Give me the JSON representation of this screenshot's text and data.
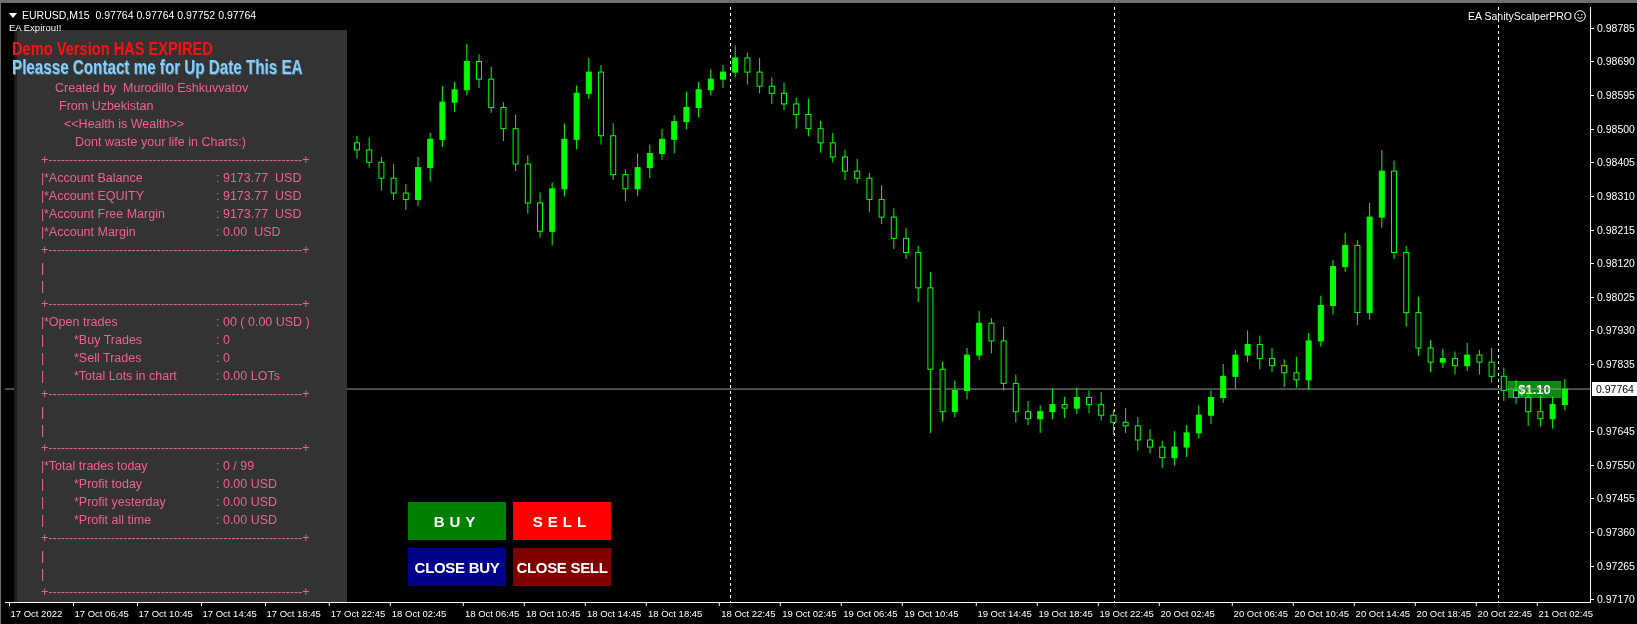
{
  "header": {
    "symbol_line": "EURUSD,M15  0.97764 0.97764 0.97752 0.97764",
    "ea_status": "EA Expirou!!",
    "ea_name": "EA SanityScalperPRO"
  },
  "alerts": [
    {
      "kind": "error",
      "text": "Demo Version HAS EXPIRED"
    },
    {
      "kind": "notice",
      "text": "Pleasse Contact me for Up Date This EA"
    }
  ],
  "panel": {
    "rows": [
      {
        "kind": "text",
        "text": "Created by  Murodillo Eshkuvvatov"
      },
      {
        "kind": "text",
        "text": "From Uzbekistan"
      },
      {
        "kind": "text",
        "text": "<<Health is Wealth>>"
      },
      {
        "kind": "text",
        "text": "Dont waste your life in Charts:)"
      },
      {
        "kind": "rule",
        "text": "+-------------------------------------------------------------+"
      },
      {
        "kind": "stat",
        "bar": "|",
        "label": "*Account Balance",
        "value": ": 9173.77  USD"
      },
      {
        "kind": "stat",
        "bar": "|",
        "label": "*Account EQUITY",
        "value": ": 9173.77  USD"
      },
      {
        "kind": "stat",
        "bar": "|",
        "label": "*Account Free Margin",
        "value": ": 9173.77  USD"
      },
      {
        "kind": "stat",
        "bar": "|",
        "label": "*Account Margin",
        "value": ": 0.00  USD"
      },
      {
        "kind": "rule",
        "text": "+-------------------------------------------------------------+"
      },
      {
        "kind": "bar",
        "text": "|"
      },
      {
        "kind": "bar",
        "text": "|"
      },
      {
        "kind": "rule",
        "text": "+-------------------------------------------------------------+"
      },
      {
        "kind": "stat",
        "bar": "|",
        "label": "*Open trades",
        "value": ": 00 ( 0.00 USD )"
      },
      {
        "kind": "substat",
        "bar": "|",
        "label": "*Buy Trades",
        "value": ": 0"
      },
      {
        "kind": "substat",
        "bar": "|",
        "label": "*Sell Trades",
        "value": ": 0"
      },
      {
        "kind": "substat",
        "bar": "|",
        "label": "*Total Lots in chart",
        "value": ": 0.00 LOTs"
      },
      {
        "kind": "rule",
        "text": "+-------------------------------------------------------------+"
      },
      {
        "kind": "bar",
        "text": "|"
      },
      {
        "kind": "bar",
        "text": "|"
      },
      {
        "kind": "rule",
        "text": "+-------------------------------------------------------------+"
      },
      {
        "kind": "stat",
        "bar": "|",
        "label": "*Total trades today",
        "value": ": 0 / 99"
      },
      {
        "kind": "substat",
        "bar": "|",
        "label": "*Profit today",
        "value": ": 0.00 USD"
      },
      {
        "kind": "substat",
        "bar": "|",
        "label": "*Profit yesterday",
        "value": ": 0.00 USD"
      },
      {
        "kind": "substat",
        "bar": "|",
        "label": "*Profit all time",
        "value": ": 0.00 USD"
      },
      {
        "kind": "rule",
        "text": "+-------------------------------------------------------------+"
      },
      {
        "kind": "bar",
        "text": "|"
      },
      {
        "kind": "bar",
        "text": "|"
      },
      {
        "kind": "rule",
        "text": "+-------------------------------------------------------------+"
      }
    ]
  },
  "buttons": [
    {
      "kind": "buy",
      "label": "BUY"
    },
    {
      "kind": "sell",
      "label": "SELL"
    },
    {
      "kind": "close_buy",
      "label": "CLOSE BUY"
    },
    {
      "kind": "close_sell",
      "label": "CLOSE SELL"
    }
  ],
  "profit_label": "$1.10",
  "current_price": "0.97764",
  "chart": {
    "chart_data": {
      "type": "candlestick",
      "categories": [
        "17 Oct 22:45",
        null,
        null,
        null,
        null,
        "18 Oct 02:45",
        null,
        null,
        null,
        null,
        null,
        "18 Oct 06:45",
        null,
        null,
        null,
        null,
        "18 Oct 10:45",
        null,
        null,
        null,
        null,
        "18 Oct 14:45",
        null,
        null,
        null,
        null,
        "18 Oct 18:45",
        null,
        null,
        null,
        null,
        null,
        "18 Oct 22:45",
        null,
        null,
        null,
        null,
        "19 Oct 02:45",
        null,
        null,
        null,
        null,
        "19 Oct 06:45",
        null,
        null,
        null,
        null,
        "19 Oct 10:45",
        null,
        null,
        null,
        null,
        null,
        "19 Oct 14:45",
        null,
        null,
        null,
        null,
        "19 Oct 18:45",
        null,
        null,
        null,
        null,
        "19 Oct 22:45",
        null,
        null,
        null,
        null,
        "20 Oct 02:45",
        null,
        null,
        null,
        null,
        null,
        "20 Oct 06:45",
        null,
        null,
        null,
        null,
        "20 Oct 10:45",
        null,
        null,
        null,
        null,
        "20 Oct 14:45",
        null,
        null,
        null,
        null,
        "20 Oct 18:45",
        null,
        null,
        null,
        null,
        "20 Oct 22:45",
        null,
        null,
        null,
        null,
        "21 Oct 02:45"
      ],
      "ohlc": [
        [
          0.9846,
          0.9848,
          0.98415,
          0.9844
        ],
        [
          0.9844,
          0.98475,
          0.9839,
          0.98405
        ],
        [
          0.98405,
          0.9842,
          0.98325,
          0.9836
        ],
        [
          0.9836,
          0.984,
          0.98298,
          0.98318
        ],
        [
          0.98318,
          0.98343,
          0.9827,
          0.983
        ],
        [
          0.983,
          0.9842,
          0.98282,
          0.9839
        ],
        [
          0.9839,
          0.98488,
          0.9835,
          0.9847
        ],
        [
          0.9847,
          0.9862,
          0.98448,
          0.98575
        ],
        [
          0.98575,
          0.98632,
          0.98547,
          0.9861
        ],
        [
          0.9861,
          0.9874,
          0.98594,
          0.9869
        ],
        [
          0.9869,
          0.9871,
          0.98615,
          0.9864
        ],
        [
          0.9864,
          0.98675,
          0.98545,
          0.9856
        ],
        [
          0.9856,
          0.98575,
          0.98465,
          0.985
        ],
        [
          0.985,
          0.9854,
          0.9838,
          0.984
        ],
        [
          0.984,
          0.98425,
          0.9826,
          0.9829
        ],
        [
          0.9829,
          0.9832,
          0.98192,
          0.9821
        ],
        [
          0.9821,
          0.98348,
          0.9817,
          0.9833
        ],
        [
          0.9833,
          0.98515,
          0.98308,
          0.9847
        ],
        [
          0.9847,
          0.98622,
          0.98442,
          0.986
        ],
        [
          0.986,
          0.987,
          0.98584,
          0.9866
        ],
        [
          0.9866,
          0.9868,
          0.98455,
          0.9848
        ],
        [
          0.9848,
          0.98515,
          0.98355,
          0.9837
        ],
        [
          0.9837,
          0.98385,
          0.98295,
          0.9833
        ],
        [
          0.9833,
          0.9843,
          0.9831,
          0.9839
        ],
        [
          0.9839,
          0.98455,
          0.9836,
          0.9843
        ],
        [
          0.9843,
          0.985,
          0.98412,
          0.9847
        ],
        [
          0.9847,
          0.98538,
          0.9843,
          0.9852
        ],
        [
          0.9852,
          0.98605,
          0.98498,
          0.9856
        ],
        [
          0.9856,
          0.98632,
          0.98532,
          0.9861
        ],
        [
          0.9861,
          0.98668,
          0.98594,
          0.9864
        ],
        [
          0.9864,
          0.9868,
          0.98615,
          0.9866
        ],
        [
          0.9866,
          0.98735,
          0.98645,
          0.987
        ],
        [
          0.987,
          0.98715,
          0.98625,
          0.9866
        ],
        [
          0.9866,
          0.987,
          0.986,
          0.9862
        ],
        [
          0.9862,
          0.98645,
          0.9857,
          0.986
        ],
        [
          0.986,
          0.9863,
          0.98552,
          0.9857
        ],
        [
          0.9857,
          0.98588,
          0.985,
          0.9854
        ],
        [
          0.9854,
          0.98585,
          0.98478,
          0.985
        ],
        [
          0.985,
          0.98522,
          0.98432,
          0.9846
        ],
        [
          0.9846,
          0.98488,
          0.98404,
          0.9842
        ],
        [
          0.9842,
          0.9844,
          0.98355,
          0.9838
        ],
        [
          0.9838,
          0.98415,
          0.98345,
          0.9836
        ],
        [
          0.9836,
          0.98375,
          0.98265,
          0.983
        ],
        [
          0.983,
          0.9834,
          0.9823,
          0.9825
        ],
        [
          0.9825,
          0.98275,
          0.9816,
          0.9819
        ],
        [
          0.9819,
          0.9822,
          0.98132,
          0.9815
        ],
        [
          0.9815,
          0.98168,
          0.9801,
          0.9805
        ],
        [
          0.9805,
          0.98095,
          0.9764,
          0.9782
        ],
        [
          0.9782,
          0.97842,
          0.97672,
          0.977
        ],
        [
          0.977,
          0.97788,
          0.97684,
          0.9776
        ],
        [
          0.9776,
          0.9788,
          0.97735,
          0.9786
        ],
        [
          0.9786,
          0.97985,
          0.97845,
          0.9795
        ],
        [
          0.9795,
          0.97965,
          0.97865,
          0.979
        ],
        [
          0.979,
          0.9794,
          0.9776,
          0.9778
        ],
        [
          0.9778,
          0.97805,
          0.9767,
          0.977
        ],
        [
          0.977,
          0.9773,
          0.97662,
          0.9768
        ],
        [
          0.9768,
          0.97718,
          0.9764,
          0.977
        ],
        [
          0.977,
          0.97765,
          0.97678,
          0.9772
        ],
        [
          0.9772,
          0.97742,
          0.97682,
          0.9771
        ],
        [
          0.9771,
          0.97768,
          0.97694,
          0.9774
        ],
        [
          0.9774,
          0.9776,
          0.97695,
          0.9772
        ],
        [
          0.9772,
          0.97755,
          0.97675,
          0.9769
        ],
        [
          0.9769,
          0.97705,
          0.97635,
          0.9767
        ],
        [
          0.9767,
          0.9771,
          0.9764,
          0.9766
        ],
        [
          0.9766,
          0.97685,
          0.9759,
          0.9762
        ],
        [
          0.9762,
          0.9765,
          0.97582,
          0.976
        ],
        [
          0.976,
          0.97618,
          0.9754,
          0.9757
        ],
        [
          0.9757,
          0.97645,
          0.97548,
          0.976
        ],
        [
          0.976,
          0.97662,
          0.97572,
          0.9764
        ],
        [
          0.9764,
          0.97718,
          0.97624,
          0.9769
        ],
        [
          0.9769,
          0.9776,
          0.97665,
          0.9774
        ],
        [
          0.9774,
          0.97835,
          0.97725,
          0.978
        ],
        [
          0.978,
          0.97875,
          0.97765,
          0.9786
        ],
        [
          0.9786,
          0.9793,
          0.9784,
          0.9789
        ],
        [
          0.9789,
          0.97915,
          0.9782,
          0.9785
        ],
        [
          0.9785,
          0.9788,
          0.97812,
          0.9783
        ],
        [
          0.9783,
          0.97848,
          0.9777,
          0.9781
        ],
        [
          0.9781,
          0.97855,
          0.97768,
          0.9779
        ],
        [
          0.9779,
          0.97922,
          0.97762,
          0.979
        ],
        [
          0.979,
          0.98028,
          0.97884,
          0.98
        ],
        [
          0.98,
          0.9813,
          0.97975,
          0.9811
        ],
        [
          0.9811,
          0.98205,
          0.98095,
          0.9817
        ],
        [
          0.9817,
          0.98185,
          0.97945,
          0.9798
        ],
        [
          0.9798,
          0.9829,
          0.9796,
          0.9825
        ],
        [
          0.9825,
          0.9844,
          0.9822,
          0.9838
        ],
        [
          0.9838,
          0.9841,
          0.98132,
          0.9815
        ],
        [
          0.9815,
          0.98168,
          0.9794,
          0.9798
        ],
        [
          0.9798,
          0.98025,
          0.97858,
          0.9788
        ],
        [
          0.9788,
          0.97902,
          0.97812,
          0.9784
        ],
        [
          0.9784,
          0.97878,
          0.97824,
          0.9785
        ],
        [
          0.9785,
          0.9787,
          0.97805,
          0.9783
        ],
        [
          0.9783,
          0.97895,
          0.97815,
          0.9786
        ],
        [
          0.9786,
          0.97875,
          0.97805,
          0.9784
        ],
        [
          0.9784,
          0.9788,
          0.97782,
          0.978
        ],
        [
          0.978,
          0.97825,
          0.9773,
          0.9776
        ],
        [
          0.9776,
          0.9779,
          0.97722,
          0.9774
        ],
        [
          0.9774,
          0.97758,
          0.9766,
          0.977
        ],
        [
          0.977,
          0.97745,
          0.97658,
          0.9768
        ],
        [
          0.9768,
          0.97742,
          0.97652,
          0.9772
        ],
        [
          0.9772,
          0.97792,
          0.97704,
          0.97764
        ]
      ],
      "ylim": [
        0.97162,
        0.98844
      ],
      "ref_lines": [
        {
          "axis": "y",
          "value": 0.97764
        }
      ],
      "yticks": [
        {
          "value": 0.98785,
          "label": "0.98785"
        },
        {
          "value": 0.9869,
          "label": "0.98690"
        },
        {
          "value": 0.98595,
          "label": "0.98595"
        },
        {
          "value": 0.985,
          "label": "0.98500"
        },
        {
          "value": 0.98405,
          "label": "0.98405"
        },
        {
          "value": 0.9831,
          "label": "0.98310"
        },
        {
          "value": 0.98215,
          "label": "0.98215"
        },
        {
          "value": 0.9812,
          "label": "0.98120"
        },
        {
          "value": 0.98025,
          "label": "0.98025"
        },
        {
          "value": 0.9793,
          "label": "0.97930"
        },
        {
          "value": 0.97835,
          "label": "0.97835"
        },
        {
          "value": 0.97645,
          "label": "0.97645"
        },
        {
          "value": 0.9755,
          "label": "0.97550"
        },
        {
          "value": 0.97455,
          "label": "0.97455"
        },
        {
          "value": 0.9736,
          "label": "0.97360"
        },
        {
          "value": 0.97265,
          "label": "0.97265"
        },
        {
          "value": 0.9717,
          "label": "0.97170"
        }
      ]
    },
    "time_labels_left": [
      "17 Oct 2022",
      "17 Oct 06:45",
      "17 Oct 10:45",
      "17 Oct 14:45",
      "17 Oct 18:45"
    ]
  }
}
